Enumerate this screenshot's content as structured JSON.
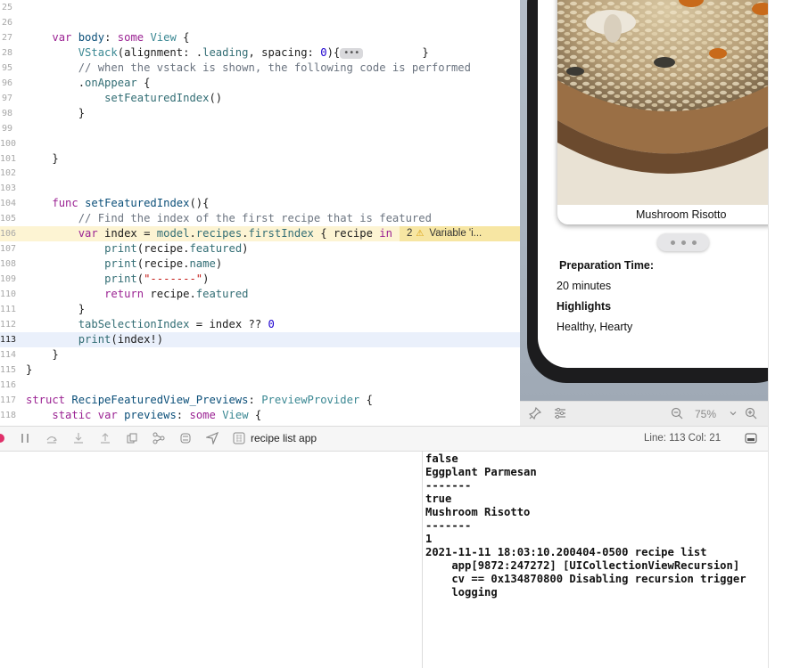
{
  "editor": {
    "lines": [
      {
        "num": "25",
        "tokens": []
      },
      {
        "num": "26",
        "tokens": []
      },
      {
        "num": "27",
        "tokens": [
          {
            "t": "    "
          },
          {
            "t": "var",
            "c": "kw"
          },
          {
            "t": " "
          },
          {
            "t": "body",
            "c": "dc"
          },
          {
            "t": ": "
          },
          {
            "t": "some",
            "c": "kw"
          },
          {
            "t": " "
          },
          {
            "t": "View",
            "c": "ty"
          },
          {
            "t": " {"
          }
        ]
      },
      {
        "num": "28",
        "tokens": [
          {
            "t": "        "
          },
          {
            "t": "VStack",
            "c": "ty"
          },
          {
            "t": "(alignment: ."
          },
          {
            "t": "leading",
            "c": "fn"
          },
          {
            "t": ", spacing: "
          },
          {
            "t": "0",
            "c": "nm"
          },
          {
            "t": "){"
          },
          {
            "t": "•••",
            "c": "fold"
          },
          {
            "t": "         }"
          }
        ]
      },
      {
        "num": "95",
        "tokens": [
          {
            "t": "        "
          },
          {
            "t": "// when the vstack is shown, the following code is performed",
            "c": "cm"
          }
        ]
      },
      {
        "num": "96",
        "tokens": [
          {
            "t": "        ."
          },
          {
            "t": "onAppear",
            "c": "fn"
          },
          {
            "t": " {"
          }
        ]
      },
      {
        "num": "97",
        "tokens": [
          {
            "t": "            "
          },
          {
            "t": "setFeaturedIndex",
            "c": "fn"
          },
          {
            "t": "()"
          }
        ]
      },
      {
        "num": "98",
        "tokens": [
          {
            "t": "        }"
          }
        ]
      },
      {
        "num": "99",
        "tokens": []
      },
      {
        "num": "100",
        "tokens": []
      },
      {
        "num": "101",
        "tokens": [
          {
            "t": "    }"
          }
        ]
      },
      {
        "num": "102",
        "tokens": []
      },
      {
        "num": "103",
        "tokens": []
      },
      {
        "num": "104",
        "tokens": [
          {
            "t": "    "
          },
          {
            "t": "func",
            "c": "kw"
          },
          {
            "t": " "
          },
          {
            "t": "setFeaturedIndex",
            "c": "dc"
          },
          {
            "t": "(){"
          }
        ]
      },
      {
        "num": "105",
        "tokens": [
          {
            "t": "        "
          },
          {
            "t": "// Find the index of the first recipe that is featured",
            "c": "cm"
          }
        ]
      },
      {
        "num": "106",
        "tokens": [
          {
            "t": "        "
          },
          {
            "t": "var",
            "c": "kw"
          },
          {
            "t": " index = "
          },
          {
            "t": "model",
            "c": "fn"
          },
          {
            "t": "."
          },
          {
            "t": "recipes",
            "c": "fn"
          },
          {
            "t": "."
          },
          {
            "t": "firstIndex",
            "c": "fn"
          },
          {
            "t": " { recipe "
          },
          {
            "t": "in",
            "c": "kw"
          }
        ]
      },
      {
        "num": "107",
        "tokens": [
          {
            "t": "            "
          },
          {
            "t": "print",
            "c": "fn"
          },
          {
            "t": "(recipe."
          },
          {
            "t": "featured",
            "c": "fn"
          },
          {
            "t": ")"
          }
        ]
      },
      {
        "num": "108",
        "tokens": [
          {
            "t": "            "
          },
          {
            "t": "print",
            "c": "fn"
          },
          {
            "t": "(recipe."
          },
          {
            "t": "name",
            "c": "fn"
          },
          {
            "t": ")"
          }
        ]
      },
      {
        "num": "109",
        "tokens": [
          {
            "t": "            "
          },
          {
            "t": "print",
            "c": "fn"
          },
          {
            "t": "("
          },
          {
            "t": "\"-------\"",
            "c": "st"
          },
          {
            "t": ")"
          }
        ]
      },
      {
        "num": "110",
        "tokens": [
          {
            "t": "            "
          },
          {
            "t": "return",
            "c": "kw"
          },
          {
            "t": " recipe."
          },
          {
            "t": "featured",
            "c": "fn"
          }
        ]
      },
      {
        "num": "111",
        "tokens": [
          {
            "t": "        }"
          }
        ]
      },
      {
        "num": "112",
        "tokens": [
          {
            "t": "        "
          },
          {
            "t": "tabSelectionIndex",
            "c": "fn"
          },
          {
            "t": " = index ?? "
          },
          {
            "t": "0",
            "c": "nm"
          }
        ]
      },
      {
        "num": "113",
        "tokens": [
          {
            "t": "        "
          },
          {
            "t": "print",
            "c": "fn"
          },
          {
            "t": "(index!)"
          }
        ]
      },
      {
        "num": "114",
        "tokens": [
          {
            "t": "    }"
          }
        ]
      },
      {
        "num": "115",
        "tokens": [
          {
            "t": "}"
          }
        ]
      },
      {
        "num": "116",
        "tokens": []
      },
      {
        "num": "117",
        "tokens": [
          {
            "t": "struct",
            "c": "kw"
          },
          {
            "t": " "
          },
          {
            "t": "RecipeFeaturedView_Previews",
            "c": "dc"
          },
          {
            "t": ": "
          },
          {
            "t": "PreviewProvider",
            "c": "ty"
          },
          {
            "t": " {"
          }
        ]
      },
      {
        "num": "118",
        "tokens": [
          {
            "t": "    "
          },
          {
            "t": "static",
            "c": "kw"
          },
          {
            "t": " "
          },
          {
            "t": "var",
            "c": "kw"
          },
          {
            "t": " "
          },
          {
            "t": "previews",
            "c": "dc"
          },
          {
            "t": ": "
          },
          {
            "t": "some",
            "c": "kw"
          },
          {
            "t": " "
          },
          {
            "t": "View",
            "c": "ty"
          },
          {
            "t": " {"
          }
        ]
      }
    ],
    "issue": {
      "count": "2",
      "message": "Variable 'i..."
    },
    "highlight_line": "106",
    "current_line": "113"
  },
  "preview": {
    "card_title": "Mushroom Risotto",
    "prep_label": "Preparation Time:",
    "prep_value": "20 minutes",
    "highlights_label": "Highlights",
    "highlights_value": "Healthy, Hearty",
    "zoom": "75%"
  },
  "debugbar": {
    "scheme": "recipe list app",
    "line_col": "Line: 113  Col: 21"
  },
  "console": {
    "lines": [
      "false",
      "Eggplant Parmesan",
      "-------",
      "true",
      "Mushroom Risotto",
      "-------",
      "1",
      "2021-11-11 18:03:10.200404-0500 recipe list",
      "    app[9872:247272] [UICollectionViewRecursion]",
      "    cv == 0x134870800 Disabling recursion trigger",
      "    logging"
    ]
  },
  "colors": {
    "accent": "#9b2393",
    "warning": "#f7e6a3",
    "current_line": "#eaf0fb"
  }
}
